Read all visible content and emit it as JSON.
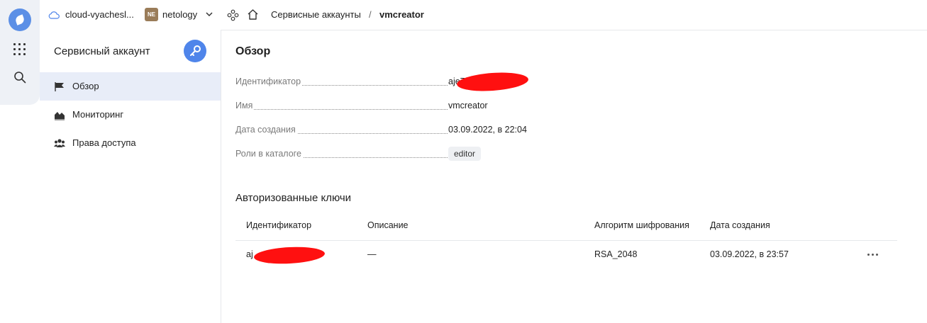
{
  "header": {
    "cloud": "cloud-vyachesl...",
    "org_badge": "NE",
    "org": "netology",
    "breadcrumb_section": "Сервисные аккаунты",
    "breadcrumb_sep": "/",
    "breadcrumb_current": "vmcreator"
  },
  "sidebar": {
    "title": "Сервисный аккаунт",
    "items": [
      {
        "label": "Обзор",
        "icon": "flag-icon",
        "active": true
      },
      {
        "label": "Мониторинг",
        "icon": "chart-icon",
        "active": false
      },
      {
        "label": "Права доступа",
        "icon": "users-icon",
        "active": false
      }
    ]
  },
  "main": {
    "title": "Обзор",
    "props": {
      "id_label": "Идентификатор",
      "id_value": "aje7                 oj4",
      "name_label": "Имя",
      "name_value": "vmcreator",
      "created_label": "Дата создания",
      "created_value": "03.09.2022, в 22:04",
      "roles_label": "Роли в каталоге",
      "roles_value": "editor"
    },
    "keys_title": "Авторизованные ключи",
    "keys_table": {
      "headers": [
        "Идентификатор",
        "Описание",
        "Алгоритм шифрования",
        "Дата создания"
      ],
      "rows": [
        {
          "id": "aj                    van",
          "description": "—",
          "algorithm": "RSA_2048",
          "created": "03.09.2022, в 23:57"
        }
      ]
    }
  },
  "colors": {
    "accent": "#4f85ea",
    "active_bg": "#e8edf8",
    "org_badge": "#9a7c59",
    "redaction": "#ff1010"
  }
}
